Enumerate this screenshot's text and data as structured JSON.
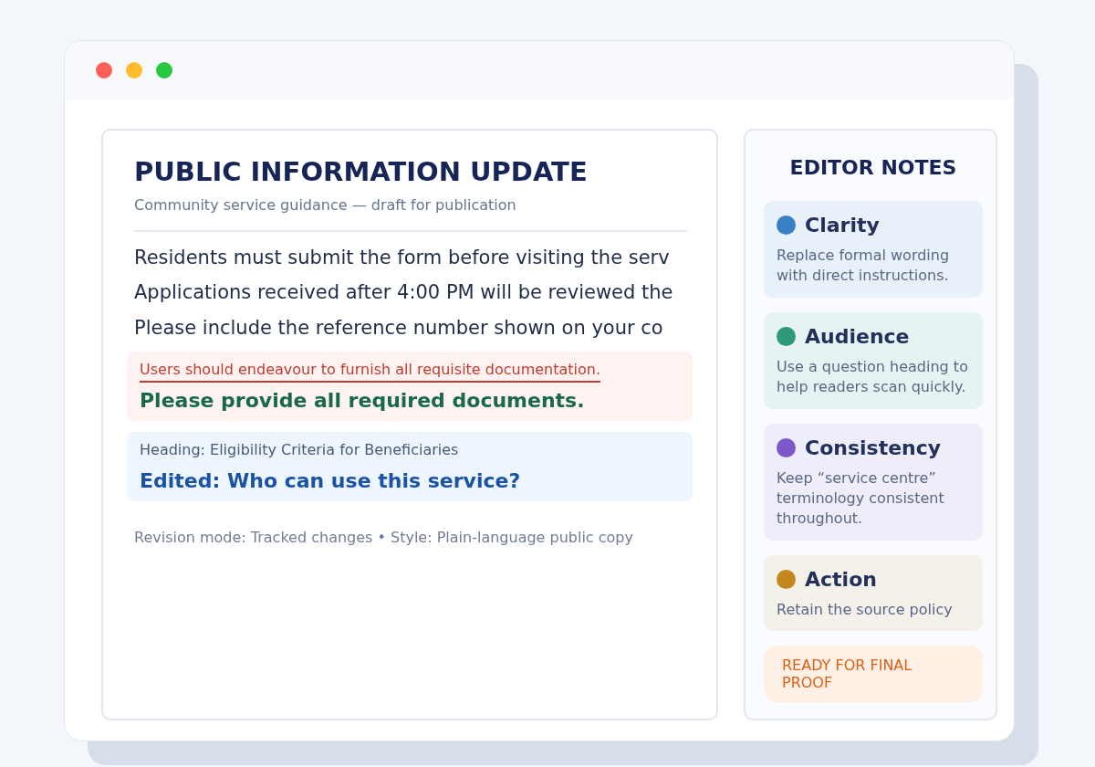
{
  "document": {
    "title": "PUBLIC INFORMATION UPDATE",
    "subtitle": "Community service guidance — draft for publication",
    "paragraphs": [
      "Residents must submit the form before visiting the serv",
      "Applications received after 4:00 PM will be reviewed the",
      "Please include the reference number shown on your co"
    ],
    "changes": [
      {
        "kind": "sentence",
        "original": "Users should endeavour to furnish all requisite documentation.",
        "revised": "Please provide all required documents."
      },
      {
        "kind": "heading",
        "original": "Heading: Eligibility Criteria for Beneficiaries",
        "revised": "Edited: Who can use this service?"
      }
    ],
    "footer": "Revision mode: Tracked changes • Style: Plain-language public copy"
  },
  "notes": {
    "title": "EDITOR NOTES",
    "items": [
      {
        "title": "Clarity",
        "color": "#3a80c4",
        "text": "Replace formal wording with direct instructions."
      },
      {
        "title": "Audience",
        "color": "#2e9a78",
        "text": "Use a question heading to help readers scan quickly."
      },
      {
        "title": "Consistency",
        "color": "#7d58c8",
        "text": "Keep “service centre” terminology consistent throughout."
      },
      {
        "title": "Action",
        "color": "#c4861e",
        "text": "Retain the source policy"
      }
    ],
    "badge": "READY FOR FINAL PROOF"
  }
}
